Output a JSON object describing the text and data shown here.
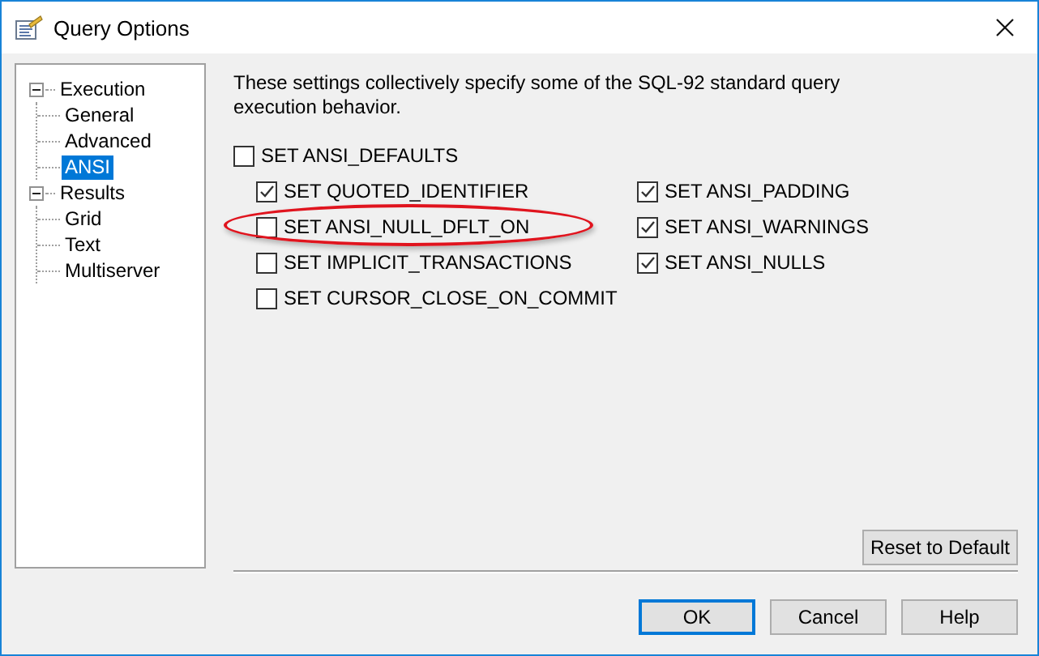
{
  "window": {
    "title": "Query Options"
  },
  "tree": [
    {
      "label": "Execution",
      "expanded": true,
      "selected": false,
      "children": [
        {
          "label": "General",
          "selected": false
        },
        {
          "label": "Advanced",
          "selected": false
        },
        {
          "label": "ANSI",
          "selected": true
        }
      ]
    },
    {
      "label": "Results",
      "expanded": true,
      "selected": false,
      "children": [
        {
          "label": "Grid",
          "selected": false
        },
        {
          "label": "Text",
          "selected": false
        },
        {
          "label": "Multiserver",
          "selected": false
        }
      ]
    }
  ],
  "description": "These settings collectively specify some of the SQL-92 standard query execution behavior.",
  "master_option": {
    "label": "SET ANSI_DEFAULTS",
    "checked": false
  },
  "left_options": [
    {
      "label": "SET QUOTED_IDENTIFIER",
      "checked": true,
      "highlighted": false
    },
    {
      "label": "SET ANSI_NULL_DFLT_ON",
      "checked": false,
      "highlighted": true
    },
    {
      "label": "SET IMPLICIT_TRANSACTIONS",
      "checked": false,
      "highlighted": false
    },
    {
      "label": "SET CURSOR_CLOSE_ON_COMMIT",
      "checked": false,
      "highlighted": false
    }
  ],
  "right_options": [
    {
      "label": "SET ANSI_PADDING",
      "checked": true,
      "highlighted": false
    },
    {
      "label": "SET ANSI_WARNINGS",
      "checked": true,
      "highlighted": false
    },
    {
      "label": "SET ANSI_NULLS",
      "checked": true,
      "highlighted": false
    }
  ],
  "reset_button": "Reset to Default",
  "buttons": [
    {
      "label": "OK",
      "default": true
    },
    {
      "label": "Cancel",
      "default": false
    },
    {
      "label": "Help",
      "default": false
    }
  ]
}
